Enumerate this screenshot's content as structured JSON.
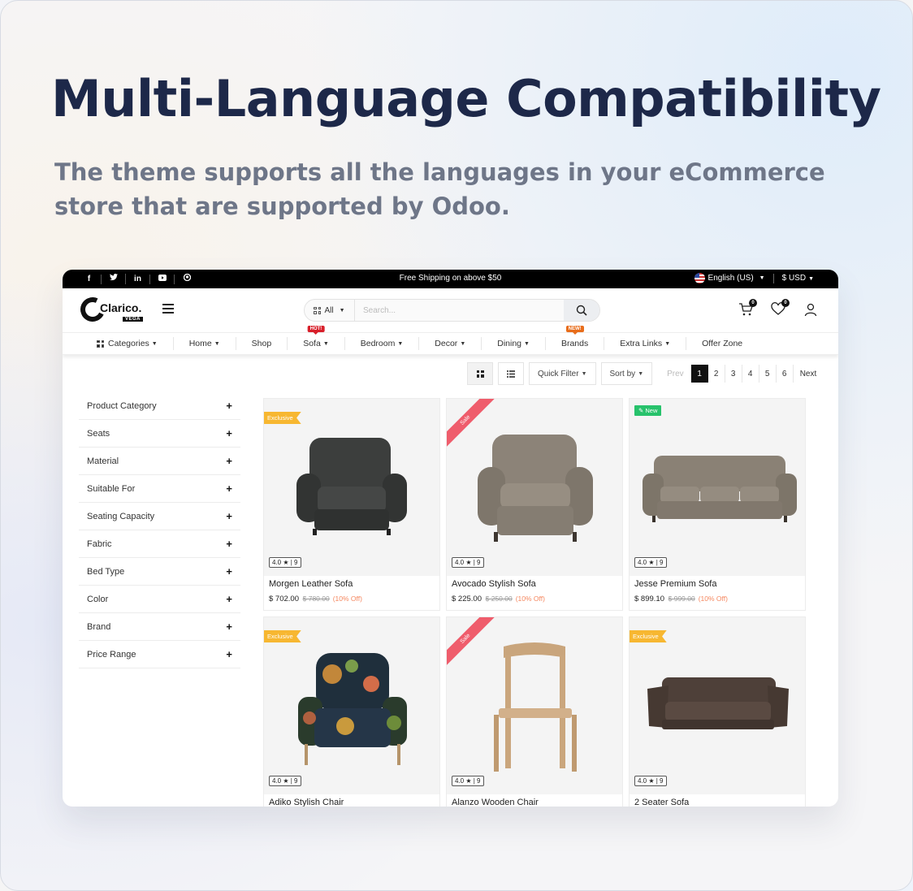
{
  "banner": {
    "headline": "Multi-Language Compatibility",
    "subline": "The theme supports all the languages in your eCommerce store that are supported by Odoo."
  },
  "topbar": {
    "socials": [
      "f",
      "t",
      "in",
      "yt",
      "gh"
    ],
    "shipping": "Free Shipping on above $50",
    "language": "English (US)",
    "currency": "$ USD"
  },
  "header": {
    "logo": "Clarico.",
    "logo_sub": "VEGA",
    "search_category": "All",
    "search_placeholder": "Search...",
    "cart_count": "0",
    "wishlist_count": "0"
  },
  "nav": {
    "categories": "Categories",
    "items": [
      {
        "label": "Home",
        "dropdown": true,
        "tag": ""
      },
      {
        "label": "Shop",
        "dropdown": false,
        "tag": ""
      },
      {
        "label": "Sofa",
        "dropdown": true,
        "tag": "HOT!"
      },
      {
        "label": "Bedroom",
        "dropdown": true,
        "tag": ""
      },
      {
        "label": "Decor",
        "dropdown": true,
        "tag": ""
      },
      {
        "label": "Dining",
        "dropdown": true,
        "tag": ""
      },
      {
        "label": "Brands",
        "dropdown": false,
        "tag": "NEW!"
      },
      {
        "label": "Extra Links",
        "dropdown": true,
        "tag": ""
      },
      {
        "label": "Offer Zone",
        "dropdown": false,
        "tag": ""
      }
    ]
  },
  "toolbar": {
    "quick_filter": "Quick Filter",
    "sort_by": "Sort by",
    "prev": "Prev",
    "pages": [
      "1",
      "2",
      "3",
      "4",
      "5",
      "6"
    ],
    "next": "Next"
  },
  "filters": [
    "Product Category",
    "Seats",
    "Material",
    "Suitable For",
    "Seating Capacity",
    "Fabric",
    "Bed Type",
    "Color",
    "Brand",
    "Price Range"
  ],
  "products": [
    {
      "name": "Morgen Leather Sofa",
      "price": "$ 702.00",
      "old": "$ 780.00",
      "off": "(10% Off)",
      "rating": "4.0 ★ | 9",
      "ribbon": "Exclusive",
      "ribbon_type": "ex"
    },
    {
      "name": "Avocado Stylish Sofa",
      "price": "$ 225.00",
      "old": "$ 250.00",
      "off": "(10% Off)",
      "rating": "4.0 ★ | 9",
      "ribbon": "Sale",
      "ribbon_type": "sale"
    },
    {
      "name": "Jesse Premium Sofa",
      "price": "$ 899.10",
      "old": "$ 999.00",
      "off": "(10% Off)",
      "rating": "4.0 ★ | 9",
      "ribbon": "New",
      "ribbon_type": "new"
    },
    {
      "name": "Adiko Stylish Chair",
      "price": "",
      "old": "",
      "off": "",
      "rating": "4.0 ★ | 9",
      "ribbon": "Exclusive",
      "ribbon_type": "ex"
    },
    {
      "name": "Alanzo Wooden Chair",
      "price": "",
      "old": "",
      "off": "",
      "rating": "4.0 ★ | 9",
      "ribbon": "Sale",
      "ribbon_type": "sale"
    },
    {
      "name": "2 Seater Sofa",
      "price": "",
      "old": "",
      "off": "",
      "rating": "4.0 ★ | 9",
      "ribbon": "Exclusive",
      "ribbon_type": "ex"
    }
  ],
  "colors": {
    "headline": "#1d2849",
    "subline": "#6e7688",
    "exclusive": "#f7b731",
    "sale": "#ef5d6c",
    "new": "#27c26b",
    "hot": "#d81f2a",
    "new_tag": "#e86d1b",
    "discount": "#f5875f"
  }
}
